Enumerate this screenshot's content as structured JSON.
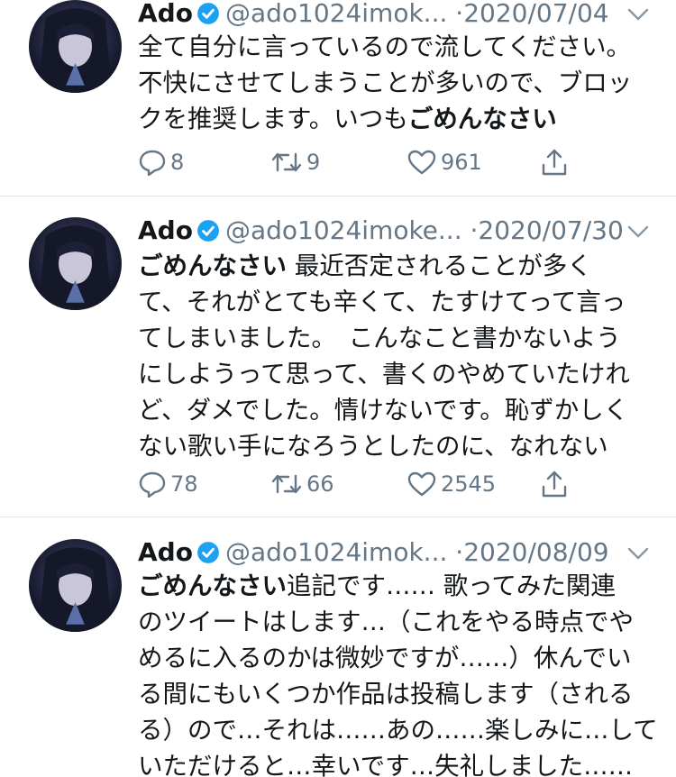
{
  "tweets": [
    {
      "name": "Ado",
      "handle": "@ado1024imok...",
      "sep": "·",
      "date": "2020/07/04",
      "lines": [
        {
          "pre": "全て自分に言っているので流してください。",
          "bold": ""
        },
        {
          "pre": "不快にさせてしまうことが多いので、ブロッ",
          "bold": ""
        },
        {
          "pre": "クを推奨します。いつも",
          "bold": "ごめんなさい"
        }
      ],
      "replies": "8",
      "retweets": "9",
      "likes": "961"
    },
    {
      "name": "Ado",
      "handle": "@ado1024imoke...",
      "sep": "·",
      "date": "2020/07/30",
      "lines": [
        {
          "bold": "ごめんなさい",
          "post": " 最近否定されることが多く"
        },
        {
          "pre": "て、それがとても辛くて、たすけてって言っ",
          "bold": ""
        },
        {
          "pre": "てしまいました。　こんなこと書かないよう",
          "bold": ""
        },
        {
          "pre": "にしようって思って、書くのやめていたけれ",
          "bold": ""
        },
        {
          "pre": "ど、ダメでした。情けないです。恥ずかしく",
          "bold": ""
        },
        {
          "pre": "ない歌い手になろうとしたのに、なれない",
          "bold": ""
        }
      ],
      "replies": "78",
      "retweets": "66",
      "likes": "2545"
    },
    {
      "name": "Ado",
      "handle": "@ado1024imok...",
      "sep": "·",
      "date": "2020/08/09",
      "lines": [
        {
          "bold": "ごめんなさい",
          "post": "追記です…… 歌ってみた関連"
        },
        {
          "pre": "のツイートはします…（これをやる時点でや",
          "bold": ""
        },
        {
          "pre": "めるに入るのかは微妙ですが……）休んでい",
          "bold": ""
        },
        {
          "pre": "る間にもいくつか作品は投稿します（される",
          "bold": ""
        },
        {
          "pre": "る）ので…それは……あの……楽しみに…して",
          "bold": ""
        },
        {
          "pre": "いただけると…幸いです…失礼しました……",
          "bold": ""
        }
      ]
    }
  ],
  "icons": {
    "verified": "verified-badge-icon",
    "caret": "chevron-down-icon",
    "reply": "reply-icon",
    "retweet": "retweet-icon",
    "like": "heart-icon",
    "share": "share-icon",
    "avatar": "avatar"
  },
  "colors": {
    "text": "#14171a",
    "muted": "#657786",
    "verified": "#1da1f2",
    "divider": "#e1e8ed"
  }
}
